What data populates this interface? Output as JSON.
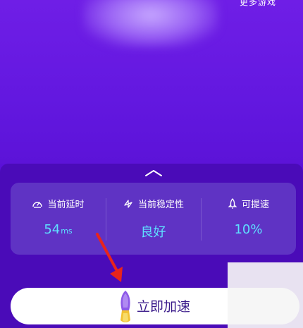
{
  "top": {
    "more_games_label": "更多游戏"
  },
  "stats": [
    {
      "label": "当前延时",
      "value": "54",
      "unit": "ms",
      "icon": "speedometer-icon"
    },
    {
      "label": "当前稳定性",
      "value": "良好",
      "unit": "",
      "icon": "stability-icon"
    },
    {
      "label": "可提速",
      "value": "10%",
      "unit": "",
      "icon": "rocket-icon"
    }
  ],
  "action": {
    "accelerate_label": "立即加速"
  },
  "colors": {
    "background": "#5a10d8",
    "panel": "#4a0bb8",
    "card": "#5f33c4",
    "value_accent": "#5fe0ff",
    "arrow": "#e8241c"
  }
}
